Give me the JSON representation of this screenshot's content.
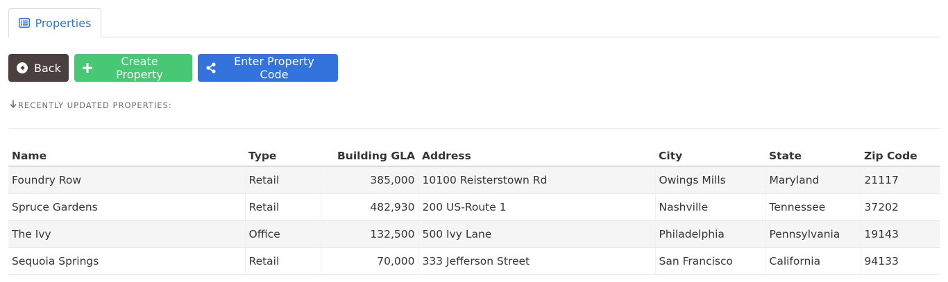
{
  "tabs": [
    {
      "label": "Properties",
      "icon": "list-icon",
      "active": true
    }
  ],
  "buttons": {
    "back_label": "Back",
    "create_label": "Create Property",
    "code_label": "Enter Property Code"
  },
  "section": {
    "label": "RECENTLY UPDATED PROPERTIES:"
  },
  "table": {
    "columns": [
      "Name",
      "Type",
      "Building GLA",
      "Address",
      "City",
      "State",
      "Zip Code"
    ],
    "rows": [
      {
        "name": "Foundry Row",
        "type": "Retail",
        "gla": "385,000",
        "address": "10100 Reisterstown Rd",
        "city": "Owings Mills",
        "state": "Maryland",
        "zip": "21117"
      },
      {
        "name": "Spruce Gardens",
        "type": "Retail",
        "gla": "482,930",
        "address": "200 US-Route 1",
        "city": "Nashville",
        "state": "Tennessee",
        "zip": "37202"
      },
      {
        "name": "The Ivy",
        "type": "Office",
        "gla": "132,500",
        "address": "500 Ivy Lane",
        "city": "Philadelphia",
        "state": "Pennsylvania",
        "zip": "19143"
      },
      {
        "name": "Sequoia Springs",
        "type": "Retail",
        "gla": "70,000",
        "address": "333 Jefferson Street",
        "city": "San Francisco",
        "state": "California",
        "zip": "94133"
      }
    ]
  },
  "colors": {
    "primary": "#3273dc",
    "success": "#48c774",
    "dark": "#4a4040"
  }
}
